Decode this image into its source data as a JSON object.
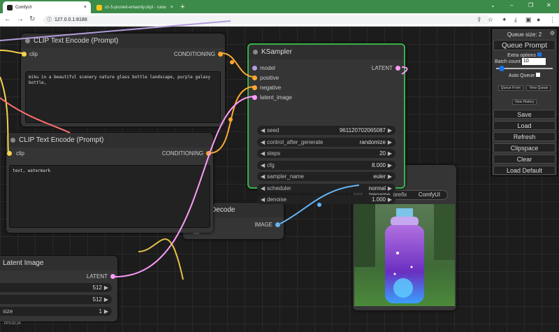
{
  "browser": {
    "tabs": [
      {
        "label": "ComfyUI",
        "active": true
      },
      {
        "label": "v1-5-pruned-emaonly.ckpt - runw",
        "active": false
      }
    ],
    "url": "127.0.0.1:8188"
  },
  "nodes": {
    "clip1": {
      "title": "CLIP Text Encode (Prompt)",
      "input": "clip",
      "output": "CONDITIONING",
      "text": "miku in a beautiful scenery nature glass bottle landscape, purple galaxy bottle,"
    },
    "clip2": {
      "title": "CLIP Text Encode (Prompt)",
      "input": "clip",
      "output": "CONDITIONING",
      "text": "text, watermark"
    },
    "ksampler": {
      "title": "KSampler",
      "inputs": [
        "model",
        "positive",
        "negative",
        "latent_image"
      ],
      "output": "LATENT",
      "widgets": [
        {
          "name": "seed",
          "value": "961120702065087"
        },
        {
          "name": "control_after_generate",
          "value": "randomize"
        },
        {
          "name": "steps",
          "value": "20"
        },
        {
          "name": "cfg",
          "value": "8.000"
        },
        {
          "name": "sampler_name",
          "value": "euler"
        },
        {
          "name": "scheduler",
          "value": "normal"
        },
        {
          "name": "denoise",
          "value": "1.000"
        }
      ]
    },
    "vae": {
      "title": "Decode",
      "output": "IMAGE",
      "input_partial": "vae"
    },
    "latent": {
      "title": "Latent Image",
      "output": "LATENT",
      "widgets": [
        {
          "name": "",
          "value": "512"
        },
        {
          "name": "",
          "value": "512"
        },
        {
          "name": "size",
          "value": "1"
        }
      ]
    },
    "save": {
      "input_partial": "images",
      "filename_label": "filename_prefix",
      "filename_value": "ComfyUI"
    }
  },
  "panel": {
    "queue_size": "Queue size: 2",
    "queue_prompt": "Queue Prompt",
    "extra_options": "Extra options",
    "batch_count_label": "Batch count",
    "batch_count": "10",
    "auto_queue": "Auto Queue",
    "queue_front": "Queue Front",
    "view_queue": "View Queue",
    "view_history": "View History",
    "buttons": [
      "Save",
      "Load",
      "Refresh",
      "Clipspace",
      "Clear",
      "Load Default"
    ]
  },
  "fps": "FPS:60.24",
  "colors": {
    "clip": "#f7d34b",
    "conditioning": "#ffa931",
    "model": "#b39ddb",
    "latent": "#ff9cf9",
    "image": "#64b5f6",
    "ksampler_border": "#38b24a"
  }
}
